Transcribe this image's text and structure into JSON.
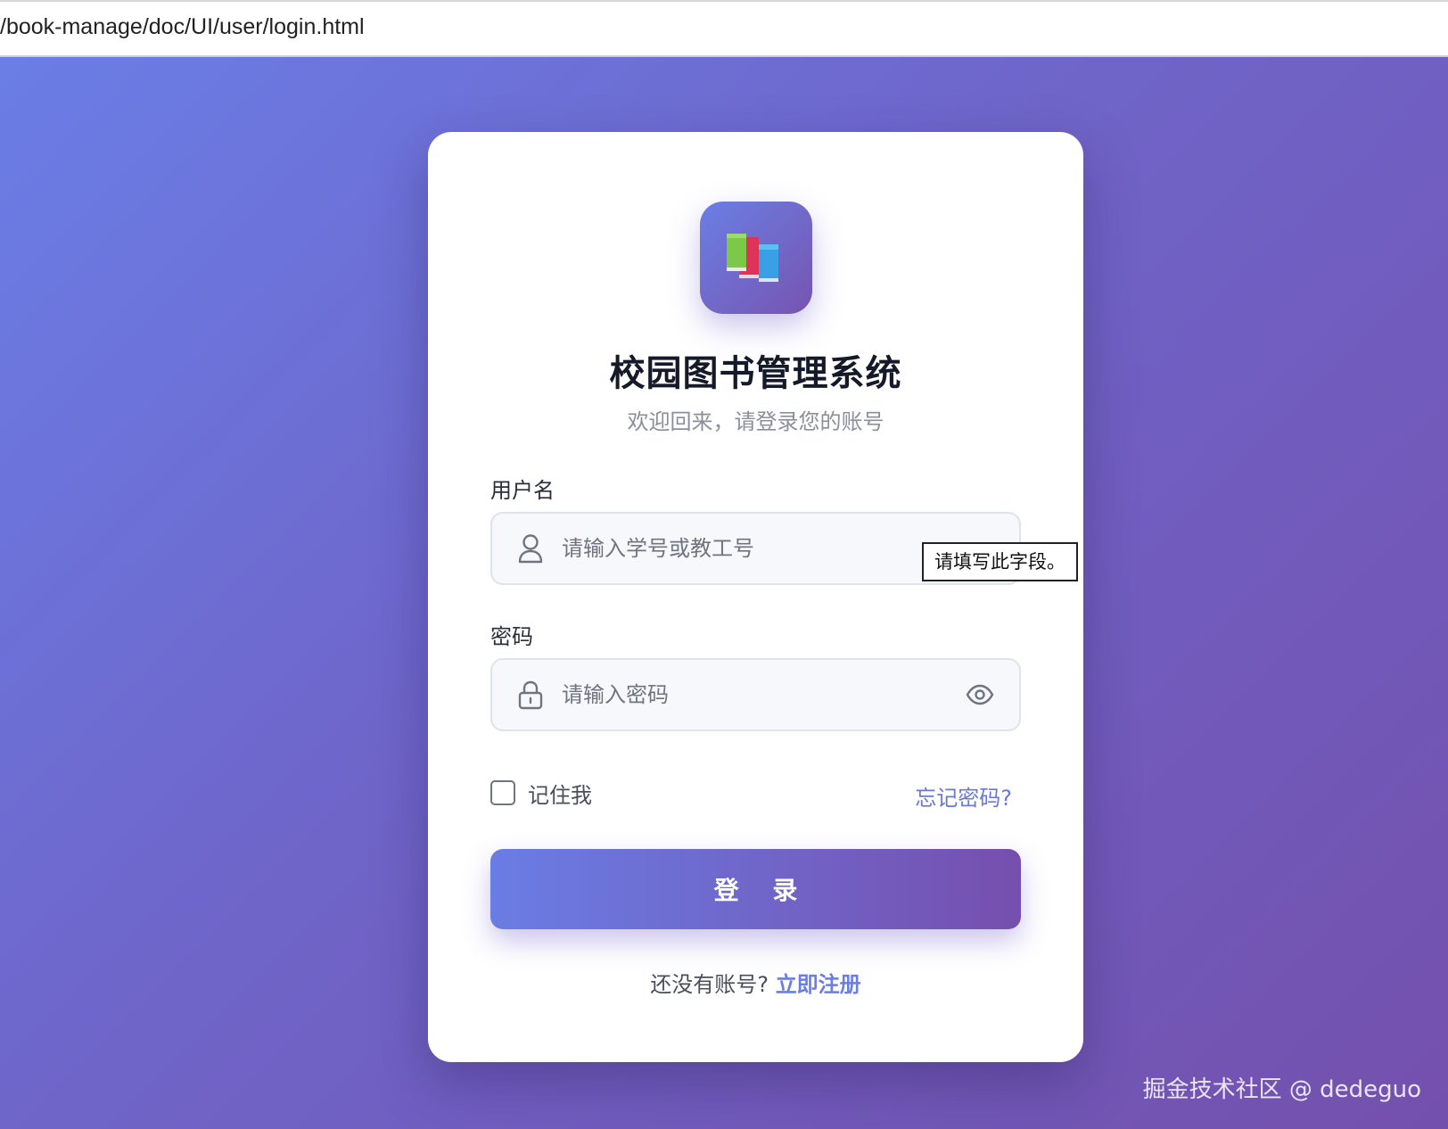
{
  "browser": {
    "url": "/book-manage/doc/UI/user/login.html"
  },
  "login_card": {
    "logo_icon": "books-icon",
    "title": "校园图书管理系统",
    "subtitle": "欢迎回来，请登录您的账号",
    "username": {
      "label": "用户名",
      "placeholder": "请输入学号或教工号",
      "value": "",
      "icon": "user-icon",
      "validation_tooltip": "请填写此字段。"
    },
    "password": {
      "label": "密码",
      "placeholder": "请输入密码",
      "value": "",
      "icon": "lock-icon",
      "toggle_icon": "eye-icon"
    },
    "remember_me": {
      "label": "记住我",
      "checked": false
    },
    "forgot_password": "忘记密码?",
    "login_button": "登 录",
    "register_prompt": "还没有账号?",
    "register_link": "立即注册"
  },
  "watermark": "掘金技术社区 @ dedeguo",
  "colors": {
    "gradient_start": "#6a7ee6",
    "gradient_end": "#7450ad",
    "link": "#6a78d6",
    "title": "#141a2a"
  }
}
